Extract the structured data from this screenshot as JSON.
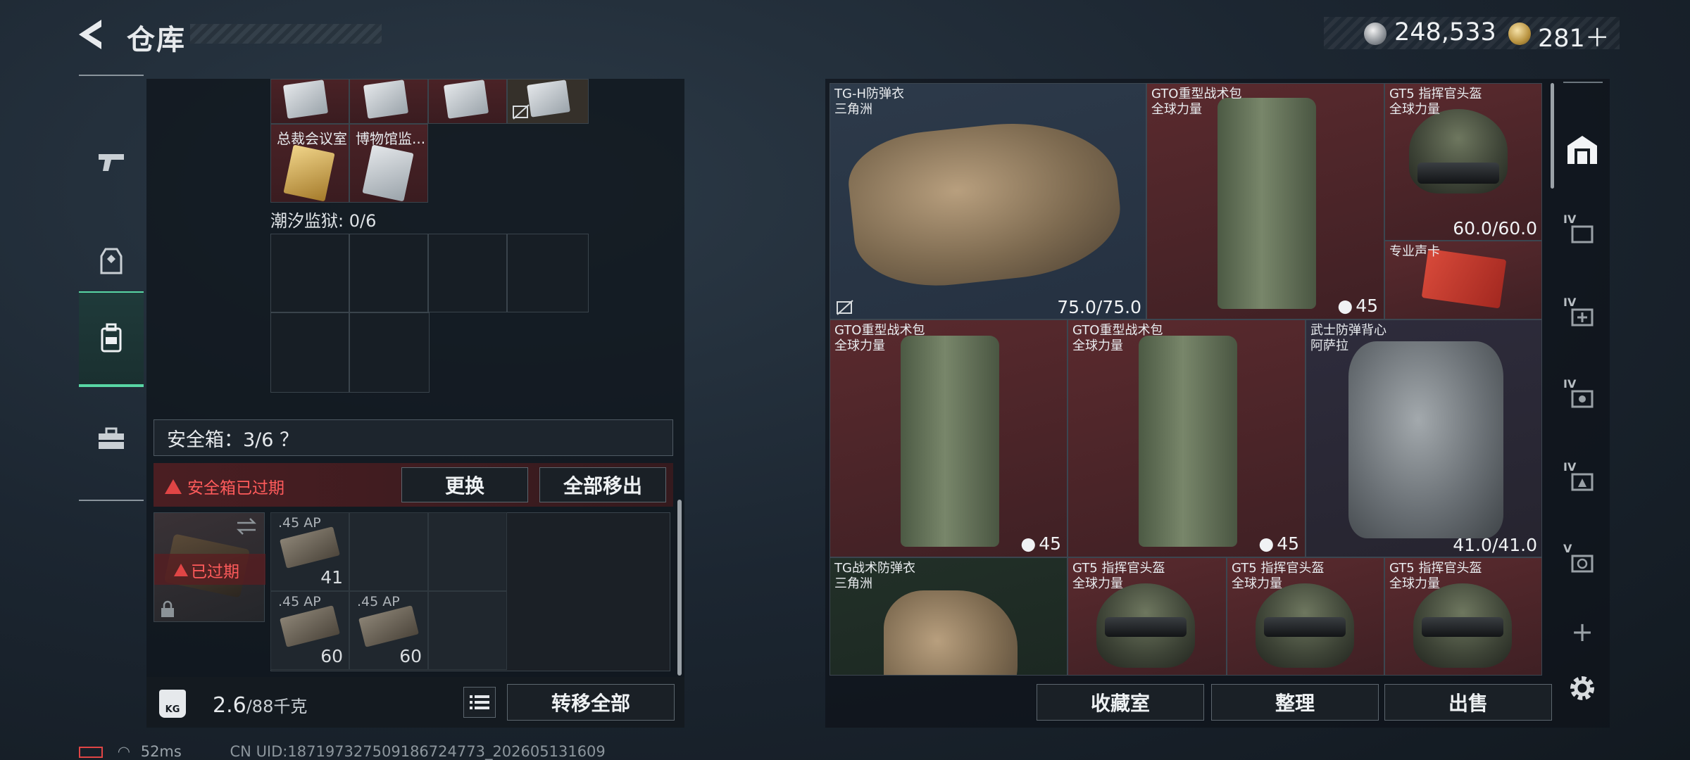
{
  "header": {
    "title": "仓库",
    "silver": "248,533",
    "gold": "281＋"
  },
  "nav": {
    "items": [
      {
        "id": "weapons",
        "icon": "pistol-icon"
      },
      {
        "id": "gear",
        "icon": "vest-icon"
      },
      {
        "id": "warehouse",
        "icon": "backpack-icon",
        "active": true
      },
      {
        "id": "supply",
        "icon": "toolbox-icon"
      }
    ]
  },
  "keys": {
    "top_row_count": 4,
    "names": [
      "总裁会议室",
      "博物馆监..."
    ]
  },
  "section": {
    "label": "潮汐监狱: 0/6"
  },
  "safebox": {
    "label": "安全箱：3/6 ？",
    "expired_text": "安全箱已过期",
    "replace_label": "更换",
    "move_all_label": "全部移出",
    "badge": "已过期"
  },
  "ammo": [
    {
      "cal": ".45 AP",
      "count": "41"
    },
    {
      "cal": ".45 AP",
      "count": "60"
    },
    {
      "cal": ".45 AP",
      "count": "60"
    }
  ],
  "footer": {
    "weight": "2.6",
    "capacity": "/88千克",
    "transfer_label": "转移全部",
    "kg_label": "KG"
  },
  "storage": [
    {
      "name": "TG-H防弹衣",
      "sub": "三角洲",
      "durability": "75.0/75.0"
    },
    {
      "name": "GTO重型战术包",
      "sub": "全球力量",
      "count": "45"
    },
    {
      "name": "GT5 指挥官头盔",
      "sub": "全球力量",
      "durability": "60.0/60.0"
    },
    {
      "name": "专业声卡",
      "sub": ""
    },
    {
      "name": "GTO重型战术包",
      "sub": "全球力量",
      "count": "45"
    },
    {
      "name": "GTO重型战术包",
      "sub": "全球力量",
      "count": "45"
    },
    {
      "name": "武士防弹背心",
      "sub": "阿萨拉",
      "durability": "41.0/41.0"
    },
    {
      "name": "TG战术防弹衣",
      "sub": "三角洲"
    },
    {
      "name": "GT5 指挥官头盔",
      "sub": "全球力量"
    },
    {
      "name": "GT5 指挥官头盔",
      "sub": "全球力量"
    },
    {
      "name": "GT5 指挥官头盔",
      "sub": "全球力量"
    }
  ],
  "actions": {
    "collection": "收藏室",
    "sort": "整理",
    "sell": "出售"
  },
  "right_sidebar": {
    "tiers": [
      "IV",
      "IV",
      "IV",
      "IV",
      "V"
    ],
    "add": "+"
  },
  "status": {
    "ping": "52ms",
    "uid": "CN UID:187197327509186724773_202605131609"
  }
}
